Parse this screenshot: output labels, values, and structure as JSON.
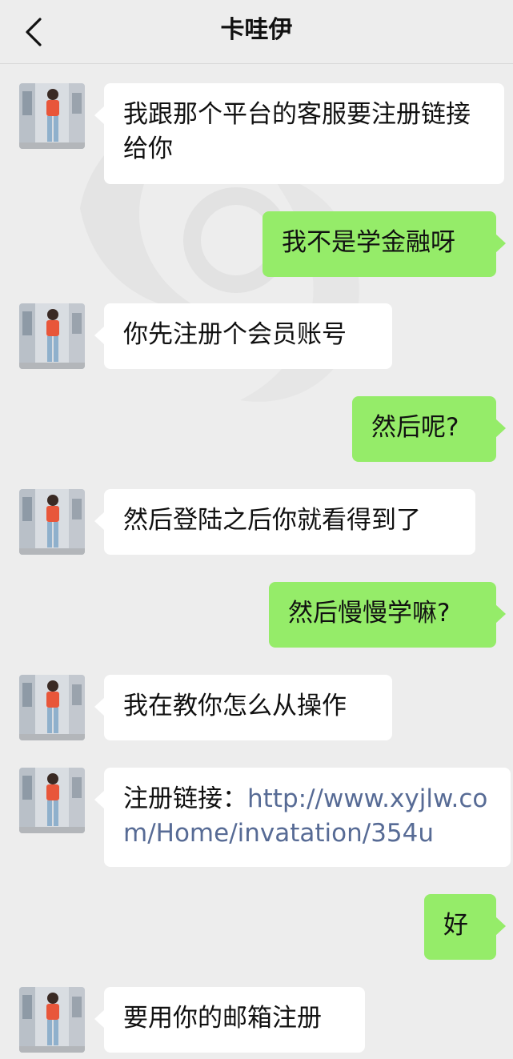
{
  "header": {
    "title": "卡哇伊",
    "back_icon": "chevron-left-icon"
  },
  "messages": [
    {
      "side": "in",
      "text": "我跟那个平台的客服要注册链接给你"
    },
    {
      "side": "out",
      "text": "我不是学金融呀"
    },
    {
      "side": "in",
      "text": "你先注册个会员账号"
    },
    {
      "side": "out",
      "text": "然后呢?"
    },
    {
      "side": "in",
      "text": "然后登陆之后你就看得到了"
    },
    {
      "side": "out",
      "text": "然后慢慢学嘛?"
    },
    {
      "side": "in",
      "text": "我在教你怎么从操作"
    },
    {
      "side": "in",
      "prefix": "注册链接：",
      "link": "http://www.xyjlw.com/Home/invatation/354u"
    },
    {
      "side": "out",
      "text": "好"
    },
    {
      "side": "in",
      "text": "要用你的邮箱注册"
    }
  ],
  "colors": {
    "background": "#ededed",
    "incoming_bubble": "#ffffff",
    "outgoing_bubble": "#95ec69",
    "link": "#576b95"
  }
}
